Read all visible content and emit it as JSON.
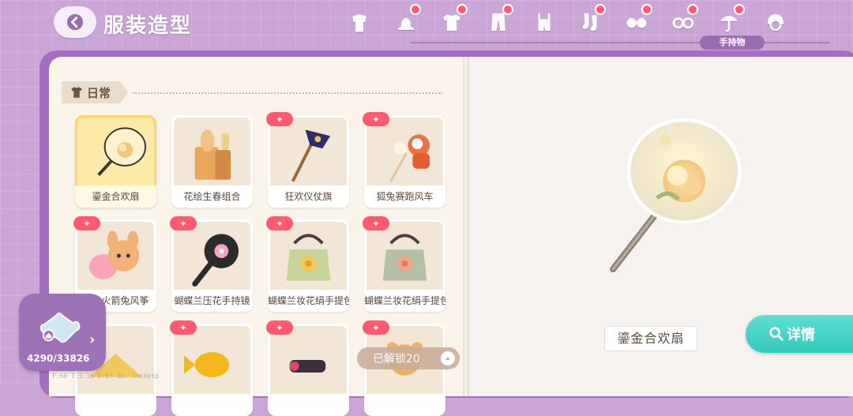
{
  "header": {
    "title": "服装造型",
    "active_tab_label": "手持物"
  },
  "category_tabs": [
    {
      "icon": "outfit-icon",
      "has_dot": false
    },
    {
      "icon": "hat-icon",
      "has_dot": true
    },
    {
      "icon": "shirt-icon",
      "has_dot": true
    },
    {
      "icon": "pants-icon",
      "has_dot": true
    },
    {
      "icon": "overalls-icon",
      "has_dot": false
    },
    {
      "icon": "socks-icon",
      "has_dot": true
    },
    {
      "icon": "shoes-icon",
      "has_dot": true
    },
    {
      "icon": "glasses-icon",
      "has_dot": true
    },
    {
      "icon": "umbrella-icon",
      "has_dot": true
    },
    {
      "icon": "hair-icon",
      "has_dot": false
    }
  ],
  "section": {
    "label": "日常"
  },
  "items": [
    {
      "name": "鎏金合欢扇",
      "selected": true,
      "new": false,
      "art": "fan"
    },
    {
      "name": "花绘生春组合",
      "selected": false,
      "new": false,
      "art": "bread"
    },
    {
      "name": "狂欢仪仗旗",
      "selected": false,
      "new": true,
      "art": "flag"
    },
    {
      "name": "狐兔赛跑风车",
      "selected": false,
      "new": true,
      "art": "fox"
    },
    {
      "name": "萝卜火箭兔风筝",
      "selected": false,
      "new": true,
      "art": "bunny"
    },
    {
      "name": "蝴蝶兰压花手持镜",
      "selected": false,
      "new": true,
      "art": "mirror"
    },
    {
      "name": "蝴蝶兰妆花绢手提包",
      "selected": false,
      "new": true,
      "art": "bag-yellow"
    },
    {
      "name": "蝴蝶兰妆花绢手提包",
      "selected": false,
      "new": true,
      "art": "bag-green"
    },
    {
      "name": "",
      "selected": false,
      "new": false,
      "art": "fan2"
    },
    {
      "name": "",
      "selected": false,
      "new": true,
      "art": "fish"
    },
    {
      "name": "",
      "selected": false,
      "new": true,
      "art": "gun"
    },
    {
      "name": "",
      "selected": false,
      "new": true,
      "art": "bear"
    }
  ],
  "unlocked": "已解锁20",
  "puzzle": {
    "count": "4290/33826"
  },
  "debug": "F:60   T:5.19   D:57   ID: 1nk8etp",
  "preview": {
    "name": "鎏金合欢扇",
    "detail_label": "详情"
  },
  "colors": {
    "accent": "#9a6cb2",
    "new_badge": "#ff5a70",
    "detail": "#3ccfc2"
  }
}
